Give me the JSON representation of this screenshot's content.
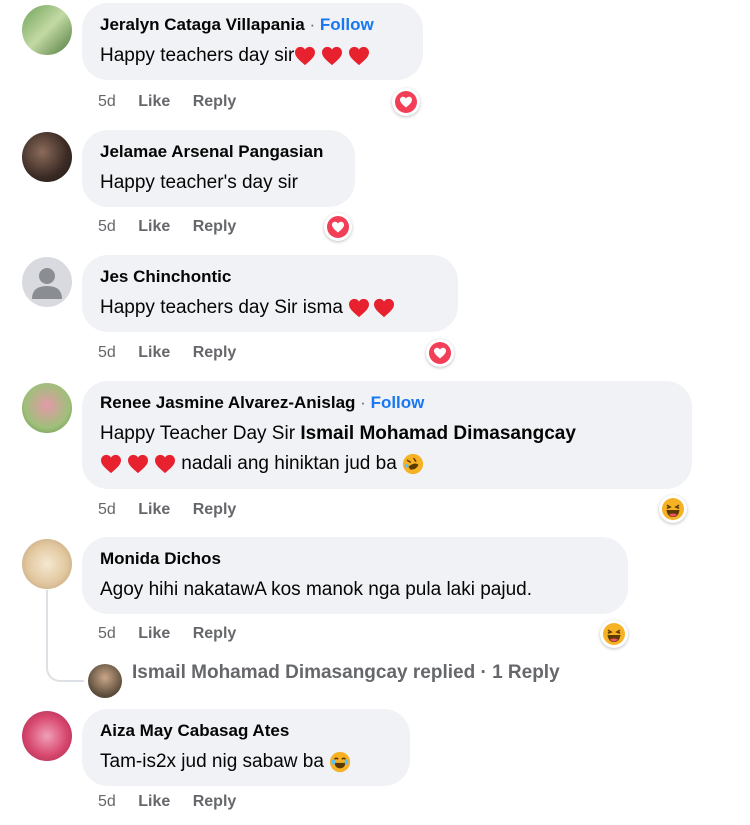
{
  "comments": [
    {
      "name": "Jeralyn Cataga Villapania",
      "follow": "Follow",
      "text": "Happy teachers day sir",
      "time": "5d",
      "like": "Like",
      "reply": "Reply",
      "reaction": "heart-react"
    },
    {
      "name": "Jelamae Arsenal Pangasian",
      "text": "Happy teacher's day sir",
      "time": "5d",
      "like": "Like",
      "reply": "Reply",
      "reaction": "heart-react"
    },
    {
      "name": "Jes Chinchontic",
      "text": "Happy teachers day Sir isma",
      "time": "5d",
      "like": "Like",
      "reply": "Reply",
      "reaction": "heart-react"
    },
    {
      "name": "Renee Jasmine Alvarez-Anislag",
      "follow": "Follow",
      "text_prefix": "Happy Teacher Day Sir ",
      "mention": "Ismail Mohamad Dimasangcay",
      "text_line2": "nadali ang hiniktan jud ba",
      "time": "5d",
      "like": "Like",
      "reply": "Reply",
      "reaction": "haha-react"
    },
    {
      "name": "Monida Dichos",
      "text": "Agoy hihi nakatawA kos manok nga pula laki pajud.",
      "time": "5d",
      "like": "Like",
      "reply": "Reply",
      "reaction": "haha-react",
      "replies_summary": "Ismail Mohamad Dimasangcay replied · 1 Reply"
    },
    {
      "name": "Aiza May Cabasag Ates",
      "text": "Tam-is2x jud nig sabaw ba",
      "time": "5d",
      "like": "Like",
      "reply": "Reply"
    }
  ],
  "separator": "·",
  "colors": {
    "bubble": "#f0f2f5",
    "link": "#1877f2",
    "meta": "#65676b",
    "heart": "#f33e58",
    "haha": "#f7b125"
  }
}
